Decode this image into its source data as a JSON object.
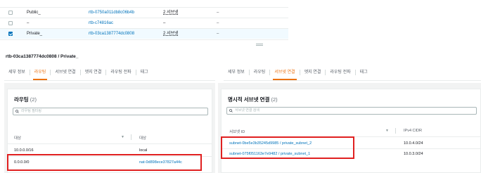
{
  "route_tables": {
    "rows": [
      {
        "name": "Public_",
        "id": "rtb-0750a011db8c06b4b",
        "subnets": "2 서브넷",
        "extra": "–",
        "selected": false
      },
      {
        "name": "–",
        "id": "rtb-c74816ac",
        "subnets": "–",
        "extra": "–",
        "selected": false
      },
      {
        "name": "Private_",
        "id": "rtb-03ca1387774dc0808",
        "subnets": "2 서브넷",
        "extra": "–",
        "selected": true
      }
    ]
  },
  "detail": {
    "title": "rtb-03ca1387774dc0808 / Private_"
  },
  "tabs_left": [
    "세부 정보",
    "라우팅",
    "서브넷 연결",
    "엣지 연결",
    "라우팅 전파",
    "태그"
  ],
  "tabs_left_active": "라우팅",
  "tabs_right": [
    "세부 정보",
    "라우팅",
    "서브넷 연결",
    "엣지 연결",
    "라우팅 전파",
    "태그"
  ],
  "tabs_right_active": "서브넷 연결",
  "routes_panel": {
    "title": "라우팅",
    "count": "(2)",
    "search_placeholder": "라우팅 필터링",
    "col_destination": "대상",
    "col_target": "대상",
    "rows": [
      {
        "destination": "10.0.0.0/16",
        "target": "local",
        "target_is_link": false
      },
      {
        "destination": "0.0.0.0/0",
        "target": "nat-0d898ece37827a44c",
        "target_is_link": true
      }
    ]
  },
  "subnets_panel": {
    "title": "명시적 서브넷 연결",
    "count": "(2)",
    "search_placeholder": "서브넷 연결 검색",
    "col_subnet_id": "서브넷 ID",
    "col_cidr": "IPv4 CIDR",
    "rows": [
      {
        "subnet": "subnet-0be5e3b35245d9985 / private_subnet_2",
        "cidr": "10.0.4.0/24"
      },
      {
        "subnet": "subnet-075f051163e7e9482 / private_subnet_1",
        "cidr": "10.0.3.0/24"
      }
    ]
  },
  "colors": {
    "link": "#0073bb",
    "active_tab": "#ec7211",
    "highlight": "#e02020"
  },
  "icons": [
    "checkbox-icon",
    "search-icon",
    "sort-down-icon",
    "resize-handle-icon"
  ]
}
